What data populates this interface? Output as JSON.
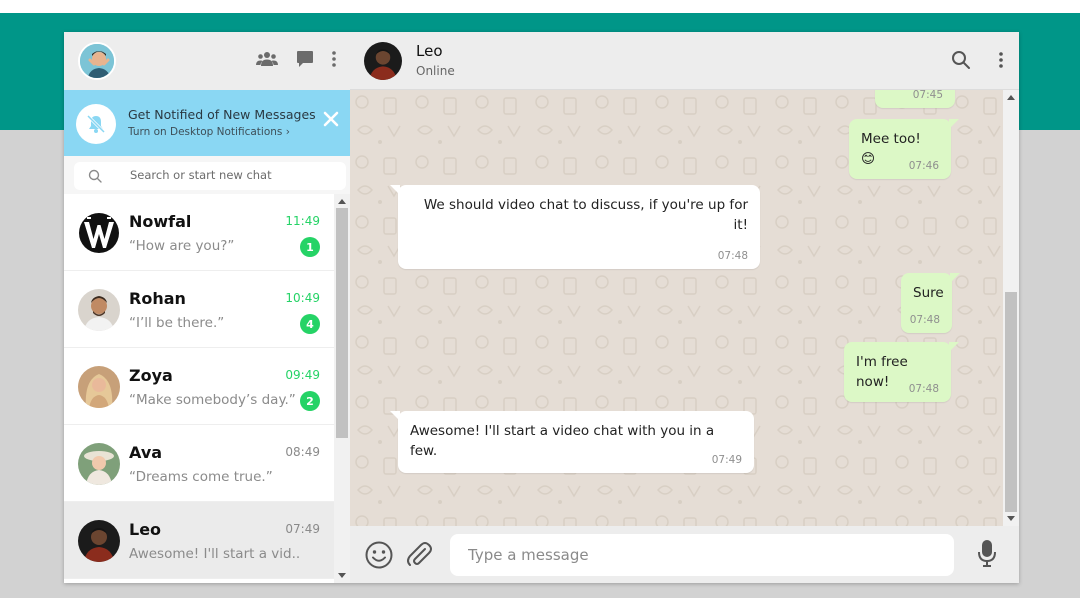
{
  "colors": {
    "teal_band": "#009688",
    "notification_bg": "#8ad7f3",
    "unread_green": "#25d366",
    "outgoing_bubble": "#dcf8c6",
    "incoming_bubble": "#ffffff",
    "chat_background": "#e5ddd5"
  },
  "sidebar": {
    "header_icons": [
      "people-icon",
      "message-square-icon",
      "more-vertical-icon"
    ],
    "notification": {
      "title": "Get Notified of New Messages",
      "subtitle": "Turn on Desktop Notifications ›"
    },
    "search": {
      "placeholder": "Search or start new chat"
    },
    "chats": [
      {
        "name": "Nowfal",
        "preview": "“How are you?”",
        "time": "11:49",
        "unread": "1"
      },
      {
        "name": "Rohan",
        "preview": "“I’ll be there.”",
        "time": "10:49",
        "unread": "4"
      },
      {
        "name": "Zoya",
        "preview": "“Make somebody’s day.”",
        "time": "09:49",
        "unread": "2"
      },
      {
        "name": "Ava",
        "preview": "“Dreams come true.”",
        "time": "08:49",
        "unread": ""
      },
      {
        "name": "Leo",
        "preview": "Awesome! I'll start a vid..",
        "time": "07:49",
        "unread": ""
      }
    ]
  },
  "conversation": {
    "contact_name": "Leo",
    "contact_status": "Online",
    "header_icons": [
      "search-icon",
      "more-vertical-icon"
    ],
    "messages": [
      {
        "direction": "out",
        "text": "",
        "time": "07:45"
      },
      {
        "direction": "out",
        "text": "Mee too! 😊",
        "time": "07:46"
      },
      {
        "direction": "in",
        "text": "We should video chat to discuss, if you're up for it!",
        "time": "07:48"
      },
      {
        "direction": "out",
        "text": "Sure",
        "time": "07:48"
      },
      {
        "direction": "out",
        "text": "I'm free now!",
        "time": "07:48"
      },
      {
        "direction": "in",
        "text": "Awesome! I'll start a video chat with you in a few.",
        "time": "07:49"
      }
    ],
    "composer": {
      "placeholder": "Type a message"
    }
  }
}
